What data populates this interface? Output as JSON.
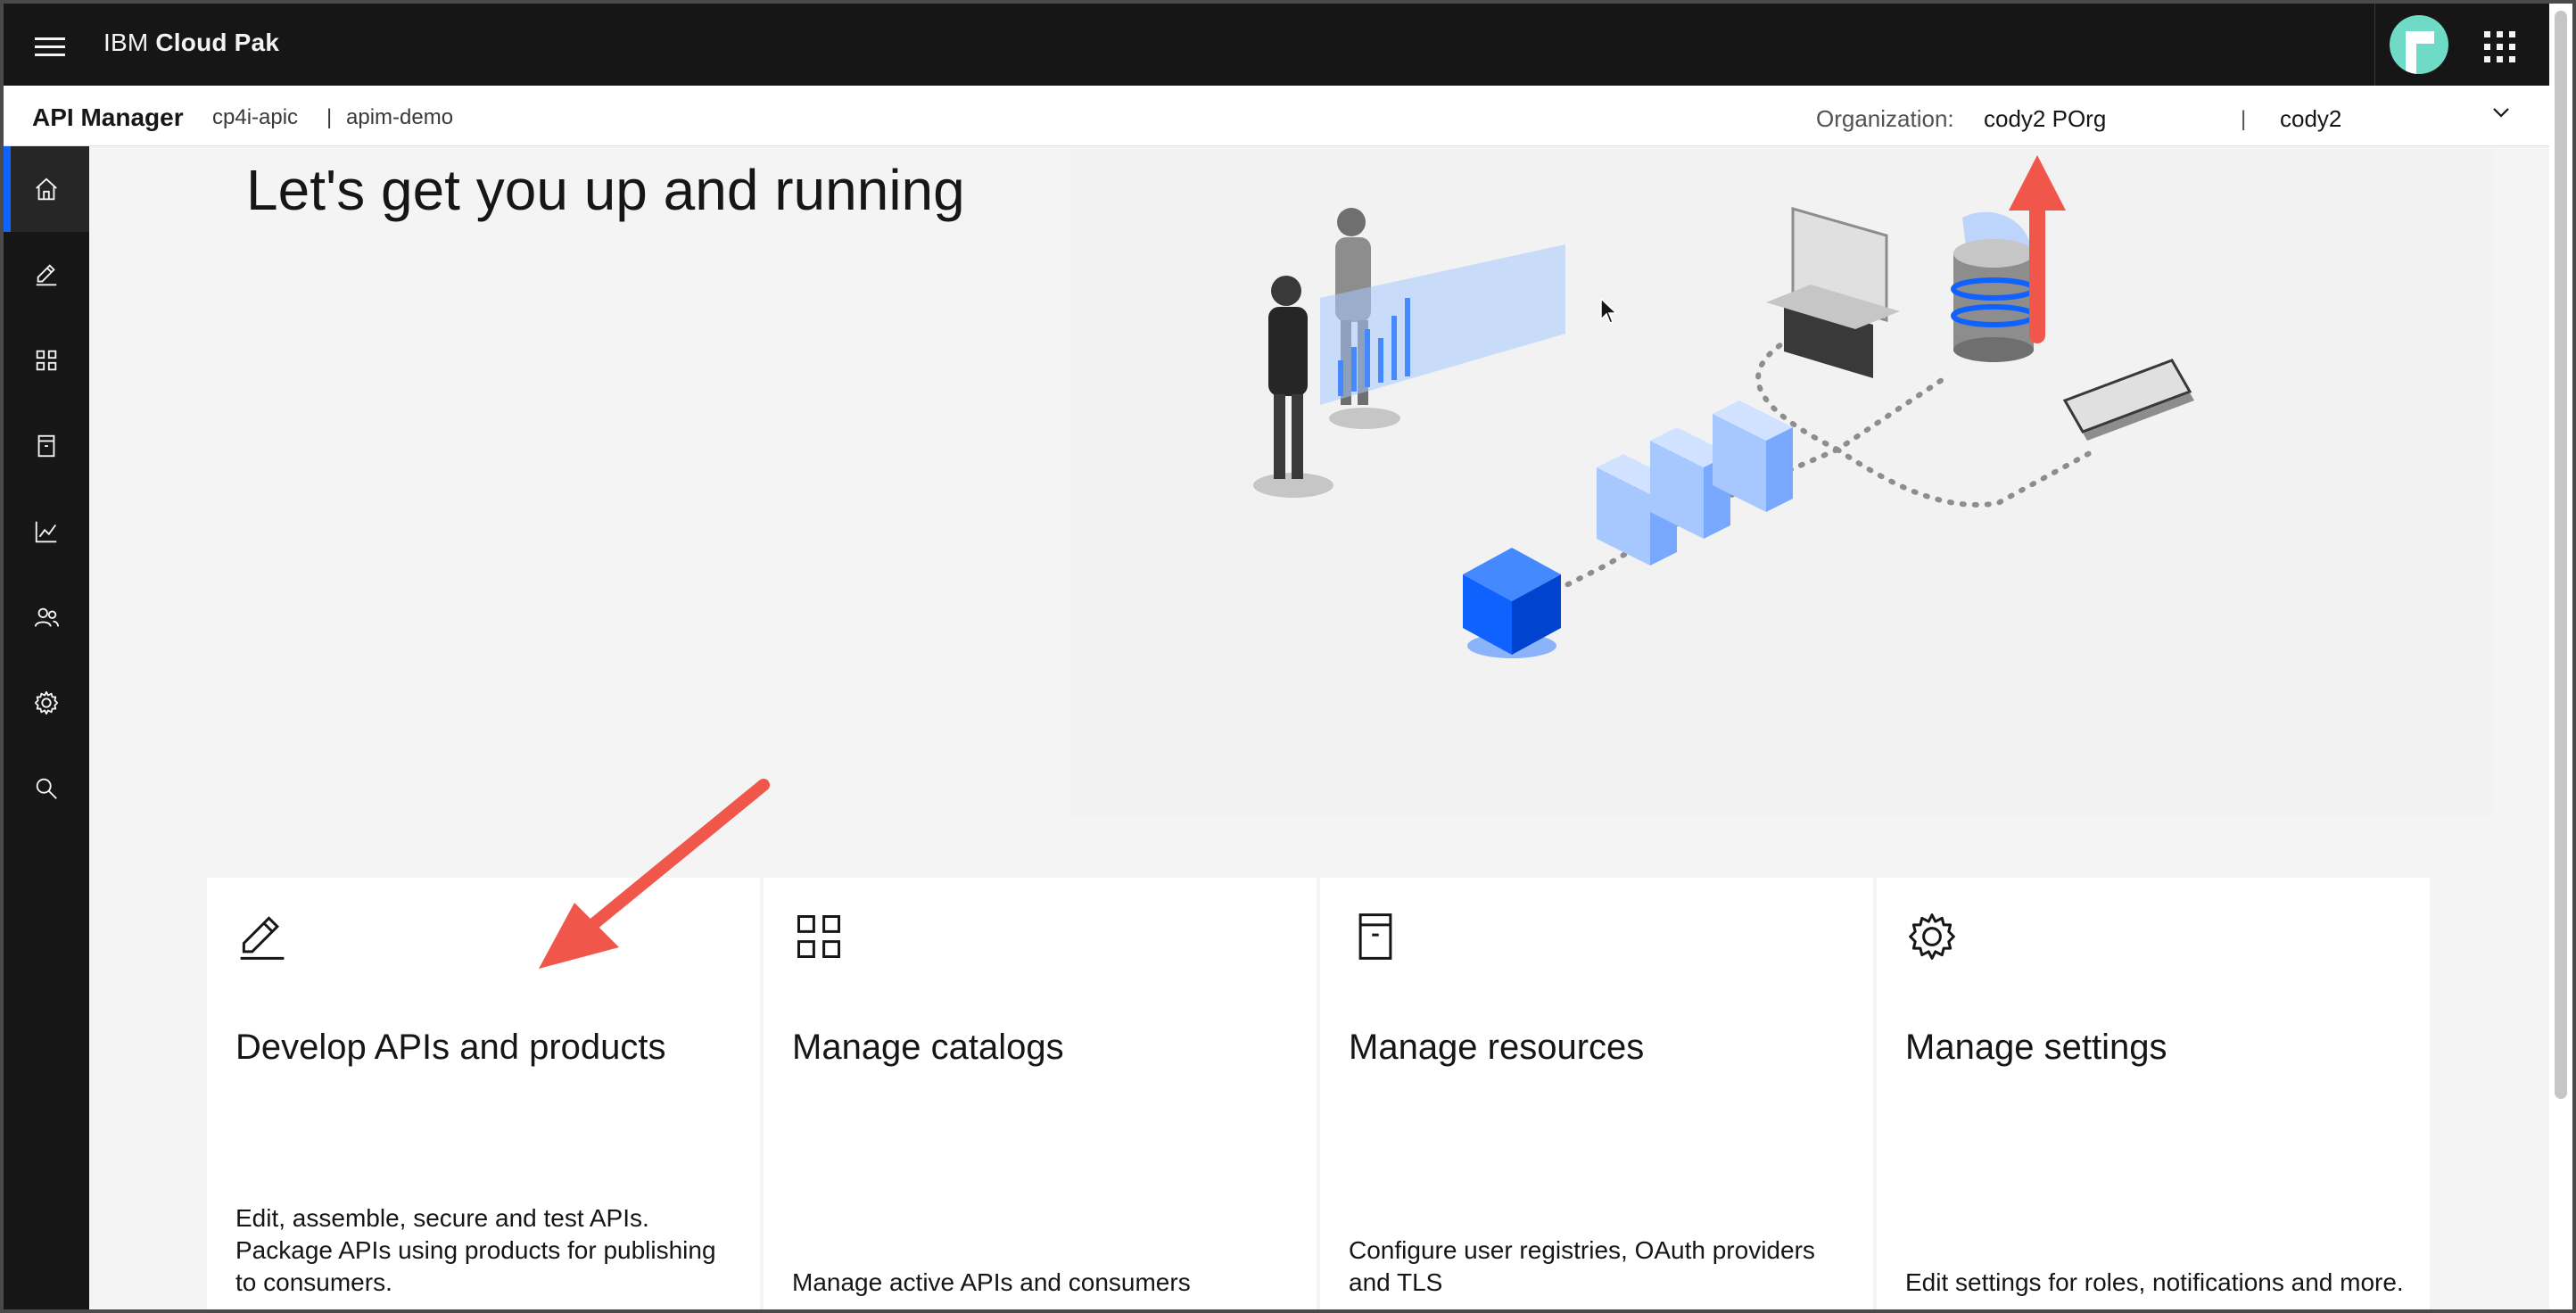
{
  "header": {
    "brand_prefix": "IBM",
    "brand_name": "Cloud Pak"
  },
  "subheader": {
    "app_title": "API Manager",
    "breadcrumb_1": "cp4i-apic",
    "separator": "|",
    "breadcrumb_2": "apim-demo",
    "org_label": "Organization:",
    "org_value": "cody2 POrg",
    "org_divider": "|",
    "user_value": "cody2"
  },
  "sidenav": {
    "items": [
      {
        "name": "home",
        "icon": "home-icon",
        "active": true
      },
      {
        "name": "develop",
        "icon": "pencil-icon",
        "active": false
      },
      {
        "name": "catalogs",
        "icon": "grid-icon",
        "active": false
      },
      {
        "name": "resources",
        "icon": "resource-icon",
        "active": false
      },
      {
        "name": "analytics",
        "icon": "chart-line-icon",
        "active": false
      },
      {
        "name": "members",
        "icon": "users-icon",
        "active": false
      },
      {
        "name": "settings",
        "icon": "gear-icon",
        "active": false
      },
      {
        "name": "search",
        "icon": "search-icon",
        "active": false
      }
    ]
  },
  "main": {
    "title": "Let's get you up and running"
  },
  "cards": [
    {
      "title": "Develop APIs and products",
      "description": "Edit, assemble, secure and test APIs. Package APIs using products for publishing to consumers.",
      "icon": "pencil-icon"
    },
    {
      "title": "Manage catalogs",
      "description": "Manage active APIs and consumers",
      "icon": "grid-icon"
    },
    {
      "title": "Manage resources",
      "description": "Configure user registries, OAuth providers and TLS",
      "icon": "resource-icon"
    },
    {
      "title": "Manage settings",
      "description": "Edit settings for roles, notifications and more.",
      "icon": "gear-icon"
    }
  ],
  "colors": {
    "header_bg": "#161616",
    "accent": "#0f62fe",
    "annotation_arrow": "#f0564a",
    "page_bg": "#f4f4f4"
  }
}
